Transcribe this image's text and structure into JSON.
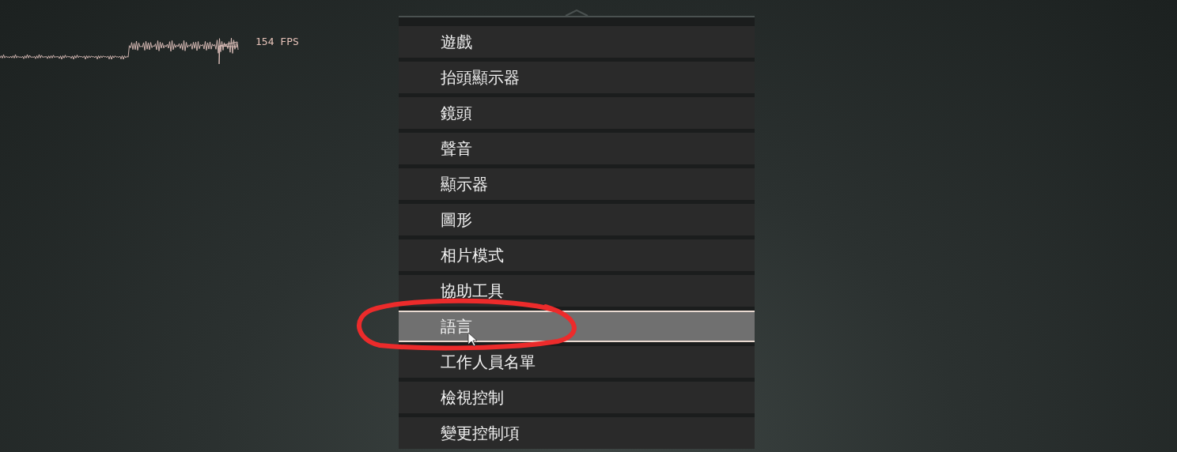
{
  "fps_counter": {
    "text": "154 FPS"
  },
  "menu": {
    "items": [
      {
        "label": "遊戲",
        "selected": false
      },
      {
        "label": "抬頭顯示器",
        "selected": false
      },
      {
        "label": "鏡頭",
        "selected": false
      },
      {
        "label": "聲音",
        "selected": false
      },
      {
        "label": "顯示器",
        "selected": false
      },
      {
        "label": "圖形",
        "selected": false
      },
      {
        "label": "相片模式",
        "selected": false
      },
      {
        "label": "協助工具",
        "selected": false
      },
      {
        "label": "語言",
        "selected": true
      },
      {
        "label": "工作人員名單",
        "selected": false
      },
      {
        "label": "檢視控制",
        "selected": false
      },
      {
        "label": "變更控制項",
        "selected": false
      }
    ]
  }
}
